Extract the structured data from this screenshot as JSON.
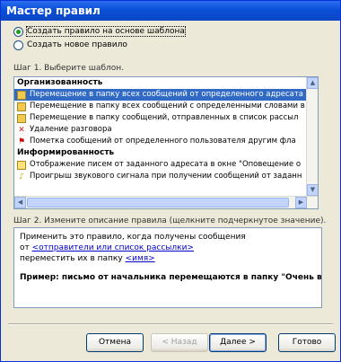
{
  "window": {
    "title": "Мастер правил"
  },
  "options": [
    {
      "label": "Создать правило на основе шаблона",
      "checked": true
    },
    {
      "label": "Создать новое правило",
      "checked": false
    }
  ],
  "step1": {
    "label": "Шаг 1. Выберите шаблон.",
    "groups": [
      {
        "header": "Организованность",
        "items": [
          {
            "icon": "move-folder-icon",
            "text": "Перемещение в папку всех сообщений от определенного адресата",
            "selected": true
          },
          {
            "icon": "move-folder-icon",
            "text": "Перемещение в папку всех сообщений с определенными словами в",
            "selected": false
          },
          {
            "icon": "move-folder-icon",
            "text": "Перемещение в папку сообщений, отправленных в список рассыл",
            "selected": false
          },
          {
            "icon": "delete-icon",
            "text": "Удаление разговора",
            "selected": false
          },
          {
            "icon": "flag-icon",
            "text": "Пометка сообщений от определенного пользователя другим фла",
            "selected": false
          }
        ]
      },
      {
        "header": "Информированность",
        "items": [
          {
            "icon": "alert-icon",
            "text": "Отображение писем от заданного адресата в окне \"Оповещение о",
            "selected": false
          },
          {
            "icon": "sound-icon",
            "text": "Проигрыш звукового сигнала при получении сообщений от заданн",
            "selected": false
          }
        ]
      }
    ]
  },
  "step2": {
    "label": "Шаг 2. Измените описание правила (щелкните подчеркнутое значение).",
    "line1": "Применить это правило, когда получены сообщения",
    "line2_prefix": "от ",
    "line2_link": "<отправители или список рассылки>",
    "line3_prefix": "переместить их в папку ",
    "line3_link": "<имя>",
    "example": "Пример: письмо от начальника перемещаются в папку \"Очень важ"
  },
  "buttons": {
    "cancel": "Отмена",
    "back": "< Назад",
    "next": "Далее >",
    "finish": "Готово"
  }
}
